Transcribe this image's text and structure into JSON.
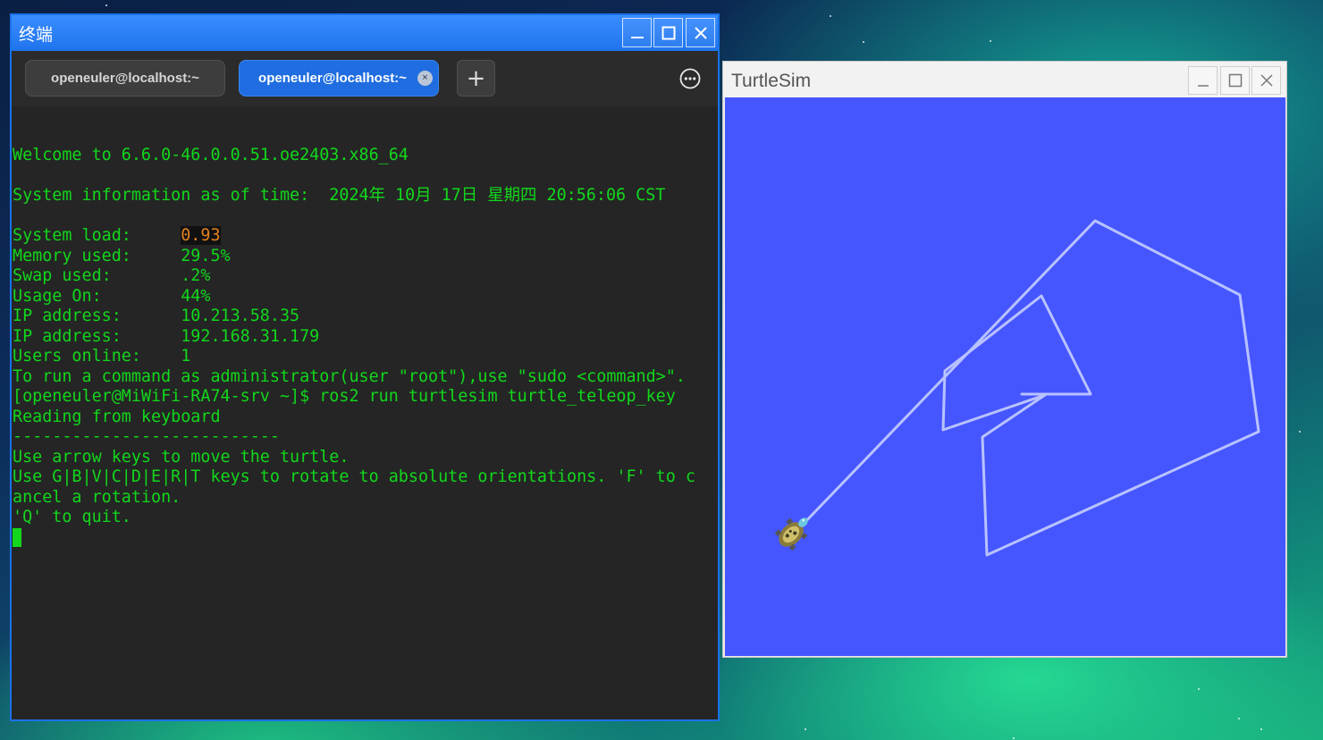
{
  "terminal": {
    "title": "终端",
    "tabs": [
      {
        "label": "openeuler@localhost:~",
        "active": false
      },
      {
        "label": "openeuler@localhost:~",
        "active": true,
        "close": "×"
      }
    ],
    "new_tab": "+",
    "lines": {
      "welcome": "Welcome to 6.6.0-46.0.0.51.oe2403.x86_64",
      "sysinfo": "System information as of time:  2024年 10月 17日 星期四 20:56:06 CST",
      "sysload_label": "System load:     ",
      "sysload_value": "0.93",
      "memory": "Memory used:     29.5%",
      "swap": "Swap used:       .2%",
      "usage": "Usage On:        44%",
      "ip1": "IP address:      10.213.58.35",
      "ip2": "IP address:      192.168.31.179",
      "users": "Users online:    1",
      "sudo": "To run a command as administrator(user \"root\"),use \"sudo <command>\".",
      "prompt": "[openeuler@MiWiFi-RA74-srv ~]$ ros2 run turtlesim turtle_teleop_key",
      "reading": "Reading from keyboard",
      "divider": "---------------------------",
      "arrows": "Use arrow keys to move the turtle.",
      "rotate1": "Use G|B|V|C|D|E|R|T keys to rotate to absolute orientations. 'F' to c",
      "rotate2": "ancel a rotation.",
      "quit": "'Q' to quit."
    }
  },
  "turtlesim": {
    "title": "TurtleSim",
    "background_color": "#4556ff",
    "path_color": "#b8c2ff"
  },
  "colors": {
    "terminal_text": "#12d71c",
    "terminal_bg": "#252525",
    "title_blue": "#1f74ec"
  },
  "icons": {
    "minimize": "minimize-icon",
    "maximize": "maximize-icon",
    "close": "close-icon",
    "menu": "more-icon"
  }
}
